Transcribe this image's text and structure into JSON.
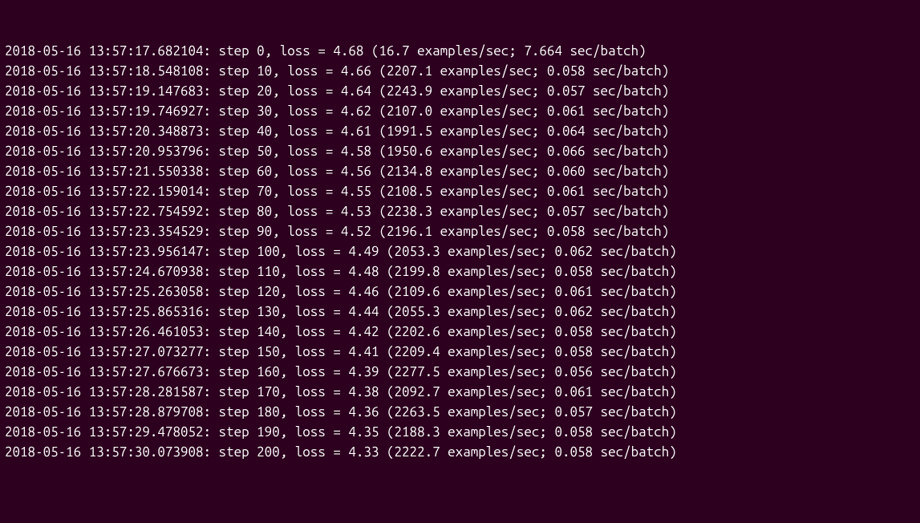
{
  "lines": [
    {
      "ts": "2018-05-16 13:57:17.682104",
      "step": 0,
      "loss": "4.68",
      "eps": "16.7",
      "spb": "7.664"
    },
    {
      "ts": "2018-05-16 13:57:18.548108",
      "step": 10,
      "loss": "4.66",
      "eps": "2207.1",
      "spb": "0.058"
    },
    {
      "ts": "2018-05-16 13:57:19.147683",
      "step": 20,
      "loss": "4.64",
      "eps": "2243.9",
      "spb": "0.057"
    },
    {
      "ts": "2018-05-16 13:57:19.746927",
      "step": 30,
      "loss": "4.62",
      "eps": "2107.0",
      "spb": "0.061"
    },
    {
      "ts": "2018-05-16 13:57:20.348873",
      "step": 40,
      "loss": "4.61",
      "eps": "1991.5",
      "spb": "0.064"
    },
    {
      "ts": "2018-05-16 13:57:20.953796",
      "step": 50,
      "loss": "4.58",
      "eps": "1950.6",
      "spb": "0.066"
    },
    {
      "ts": "2018-05-16 13:57:21.550338",
      "step": 60,
      "loss": "4.56",
      "eps": "2134.8",
      "spb": "0.060"
    },
    {
      "ts": "2018-05-16 13:57:22.159014",
      "step": 70,
      "loss": "4.55",
      "eps": "2108.5",
      "spb": "0.061"
    },
    {
      "ts": "2018-05-16 13:57:22.754592",
      "step": 80,
      "loss": "4.53",
      "eps": "2238.3",
      "spb": "0.057"
    },
    {
      "ts": "2018-05-16 13:57:23.354529",
      "step": 90,
      "loss": "4.52",
      "eps": "2196.1",
      "spb": "0.058"
    },
    {
      "ts": "2018-05-16 13:57:23.956147",
      "step": 100,
      "loss": "4.49",
      "eps": "2053.3",
      "spb": "0.062"
    },
    {
      "ts": "2018-05-16 13:57:24.670938",
      "step": 110,
      "loss": "4.48",
      "eps": "2199.8",
      "spb": "0.058"
    },
    {
      "ts": "2018-05-16 13:57:25.263058",
      "step": 120,
      "loss": "4.46",
      "eps": "2109.6",
      "spb": "0.061"
    },
    {
      "ts": "2018-05-16 13:57:25.865316",
      "step": 130,
      "loss": "4.44",
      "eps": "2055.3",
      "spb": "0.062"
    },
    {
      "ts": "2018-05-16 13:57:26.461053",
      "step": 140,
      "loss": "4.42",
      "eps": "2202.6",
      "spb": "0.058"
    },
    {
      "ts": "2018-05-16 13:57:27.073277",
      "step": 150,
      "loss": "4.41",
      "eps": "2209.4",
      "spb": "0.058"
    },
    {
      "ts": "2018-05-16 13:57:27.676673",
      "step": 160,
      "loss": "4.39",
      "eps": "2277.5",
      "spb": "0.056"
    },
    {
      "ts": "2018-05-16 13:57:28.281587",
      "step": 170,
      "loss": "4.38",
      "eps": "2092.7",
      "spb": "0.061"
    },
    {
      "ts": "2018-05-16 13:57:28.879708",
      "step": 180,
      "loss": "4.36",
      "eps": "2263.5",
      "spb": "0.057"
    },
    {
      "ts": "2018-05-16 13:57:29.478052",
      "step": 190,
      "loss": "4.35",
      "eps": "2188.3",
      "spb": "0.058"
    },
    {
      "ts": "2018-05-16 13:57:30.073908",
      "step": 200,
      "loss": "4.33",
      "eps": "2222.7",
      "spb": "0.058"
    }
  ]
}
